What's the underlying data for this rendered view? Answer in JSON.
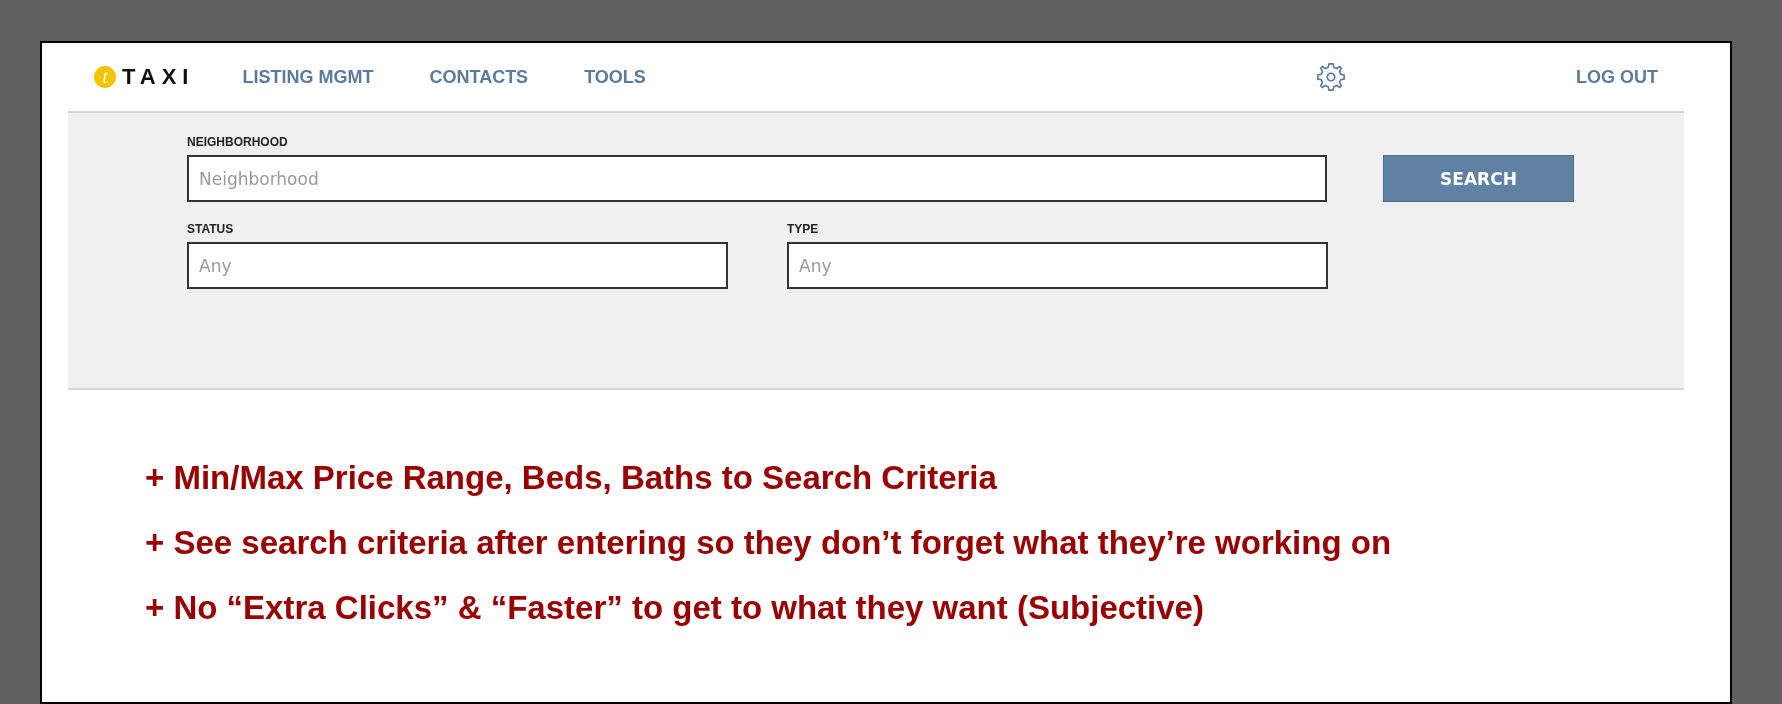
{
  "header": {
    "logo_letter": "t",
    "logo_text": "TAXI",
    "nav": [
      {
        "label": "LISTING MGMT"
      },
      {
        "label": "CONTACTS"
      },
      {
        "label": "TOOLS"
      }
    ],
    "logout": "LOG OUT"
  },
  "search_panel": {
    "fields": [
      {
        "kind": "wide",
        "label": "NEIGHBORHOOD",
        "placeholder": "Neighborhood"
      },
      {
        "kind": "half",
        "label": "STATUS",
        "placeholder": "Any"
      },
      {
        "kind": "half",
        "label": "TYPE",
        "placeholder": "Any"
      }
    ],
    "button": "SEARCH"
  },
  "notes": [
    "+ Min/Max Price Range, Beds, Baths to Search Criteria",
    "+ See search criteria after entering so they don’t forget what they’re working on",
    "+ No “Extra Clicks” & “Faster” to get to what they want (Subjective)"
  ]
}
